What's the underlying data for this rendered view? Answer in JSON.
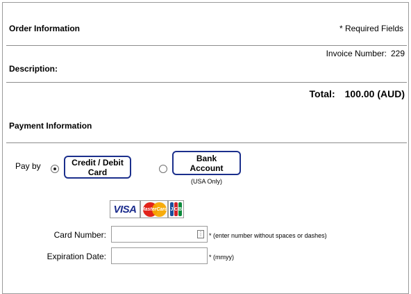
{
  "order": {
    "title": "Order Information",
    "required_note": "* Required Fields",
    "invoice_label": "Invoice Number:",
    "invoice_number": "229",
    "description_label": "Description:",
    "total_label": "Total:",
    "total_value": "100.00 (AUD)"
  },
  "payment": {
    "title": "Payment Information",
    "pay_by_label": "Pay by",
    "options": [
      {
        "label": "Credit / Debit\nCard",
        "selected": true
      },
      {
        "label": "Bank\nAccount",
        "selected": false,
        "note": "(USA Only)"
      }
    ],
    "card_logos": [
      "visa-icon",
      "mastercard-icon",
      "jcb-icon"
    ],
    "mastercard_text": "MasterCard",
    "visa_text": "VISA",
    "jcb_letters": [
      "J",
      "C",
      "B"
    ],
    "card_number": {
      "label": "Card Number:",
      "value": "",
      "hint": "* (enter number without spaces or dashes)"
    },
    "expiration": {
      "label": "Expiration Date:",
      "value": "",
      "hint": "* (mmyy)"
    }
  },
  "colors": {
    "button_border": "#1b2f8c",
    "visa_blue": "#1a2b8c",
    "mc_red": "#e2231a",
    "mc_yellow": "#f7a800",
    "jcb_blue": "#1b4f9c",
    "jcb_red": "#d1232a",
    "jcb_green": "#0a8a3a"
  }
}
